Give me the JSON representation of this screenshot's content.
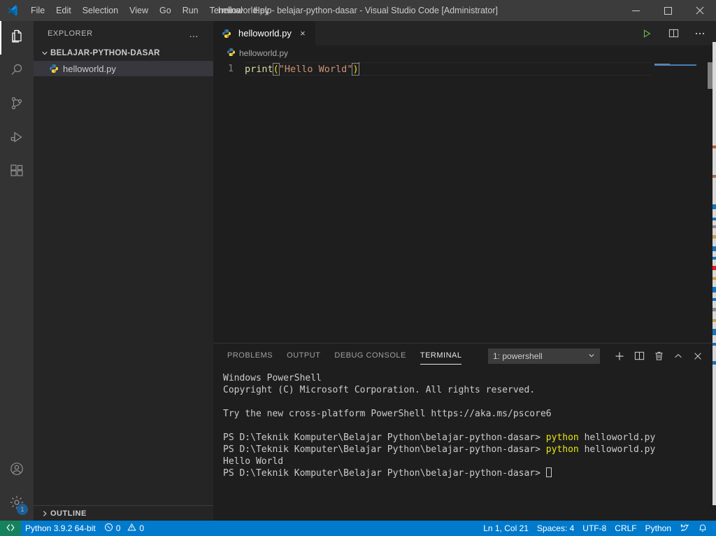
{
  "titlebar": {
    "logo_icon": "vscode-logo-icon",
    "menu": [
      "File",
      "Edit",
      "Selection",
      "View",
      "Go",
      "Run",
      "Terminal",
      "Help"
    ],
    "window_title": "helloworld.py - belajar-python-dasar - Visual Studio Code [Administrator]",
    "controls": {
      "minimize": "minimize-icon",
      "maximize": "maximize-icon",
      "close": "close-icon"
    }
  },
  "activitybar": {
    "items": [
      {
        "name": "explorer",
        "icon": "files-icon",
        "active": true
      },
      {
        "name": "search",
        "icon": "search-icon",
        "active": false
      },
      {
        "name": "source-control",
        "icon": "source-control-icon",
        "active": false
      },
      {
        "name": "run-and-debug",
        "icon": "run-debug-icon",
        "active": false
      },
      {
        "name": "extensions",
        "icon": "extensions-icon",
        "active": false
      }
    ],
    "bottom": [
      {
        "name": "accounts",
        "icon": "account-icon",
        "badge": ""
      },
      {
        "name": "manage",
        "icon": "gear-icon",
        "badge": "1"
      }
    ]
  },
  "sidebar": {
    "title": "EXPLORER",
    "more_actions": "…",
    "folder": "BELAJAR-PYTHON-DASAR",
    "folder_chevron": "chevron-down-icon",
    "files": [
      {
        "name": "helloworld.py",
        "icon": "python-file-icon",
        "selected": true
      }
    ],
    "outline": "OUTLINE",
    "outline_chevron": "chevron-right-icon"
  },
  "editor": {
    "tabs": [
      {
        "label": "helloworld.py",
        "icon": "python-file-icon",
        "close": "×",
        "active": true
      }
    ],
    "actions": [
      {
        "name": "run-python-file",
        "icon": "play-icon"
      },
      {
        "name": "split-editor",
        "icon": "split-editor-icon"
      },
      {
        "name": "more-actions",
        "icon": "ellipsis-icon"
      }
    ],
    "breadcrumb": "helloworld.py",
    "breadcrumb_icon": "python-file-icon",
    "code": {
      "line_number": "1",
      "tokens": [
        {
          "text": "print",
          "kind": "function"
        },
        {
          "text": "(",
          "kind": "bracket"
        },
        {
          "text": "\"Hello World\"",
          "kind": "string"
        },
        {
          "text": ")",
          "kind": "bracket"
        }
      ],
      "full_text": "print(\"Hello World\")"
    }
  },
  "panel": {
    "tabs": [
      {
        "label": "PROBLEMS",
        "active": false
      },
      {
        "label": "OUTPUT",
        "active": false
      },
      {
        "label": "DEBUG CONSOLE",
        "active": false
      },
      {
        "label": "TERMINAL",
        "active": true
      }
    ],
    "terminal_selector": {
      "value": "1: powershell",
      "caret_icon": "chevron-down-icon"
    },
    "actions": [
      {
        "name": "new-terminal",
        "icon": "plus-icon"
      },
      {
        "name": "split-terminal",
        "icon": "split-icon"
      },
      {
        "name": "kill-terminal",
        "icon": "trash-icon"
      },
      {
        "name": "maximize-panel",
        "icon": "chevron-up-icon"
      },
      {
        "name": "close-panel",
        "icon": "close-icon"
      }
    ],
    "terminal_lines": [
      {
        "plain": "Windows PowerShell"
      },
      {
        "plain": "Copyright (C) Microsoft Corporation. All rights reserved."
      },
      {
        "plain": ""
      },
      {
        "plain": "Try the new cross-platform PowerShell https://aka.ms/pscore6"
      },
      {
        "plain": ""
      },
      {
        "prompt": "PS D:\\Teknik Komputer\\Belajar Python\\belajar-python-dasar> ",
        "cmd": "python",
        "arg": " helloworld.py"
      },
      {
        "prompt": "PS D:\\Teknik Komputer\\Belajar Python\\belajar-python-dasar> ",
        "cmd": "python",
        "arg": " helloworld.py"
      },
      {
        "plain": "Hello World"
      },
      {
        "prompt": "PS D:\\Teknik Komputer\\Belajar Python\\belajar-python-dasar> ",
        "cursor": true
      }
    ]
  },
  "statusbar": {
    "remote_icon": "remote-window-icon",
    "interpreter": "Python 3.9.2 64-bit",
    "errors_icon": "error-icon",
    "errors": "0",
    "warnings_icon": "warning-icon",
    "warnings": "0",
    "cursor_position": "Ln 1, Col 21",
    "indentation": "Spaces: 4",
    "encoding": "UTF-8",
    "eol": "CRLF",
    "language": "Python",
    "feedback_icon": "tweet-feedback-icon",
    "notifications_icon": "bell-icon"
  },
  "colors": {
    "accent": "#007acc",
    "remote_green": "#16825d",
    "editor_bg": "#1e1e1e",
    "sidebar_bg": "#252526",
    "activitybar_bg": "#333333",
    "titlebar_bg": "#3c3c3c",
    "badge_blue": "#0e7ad4"
  }
}
